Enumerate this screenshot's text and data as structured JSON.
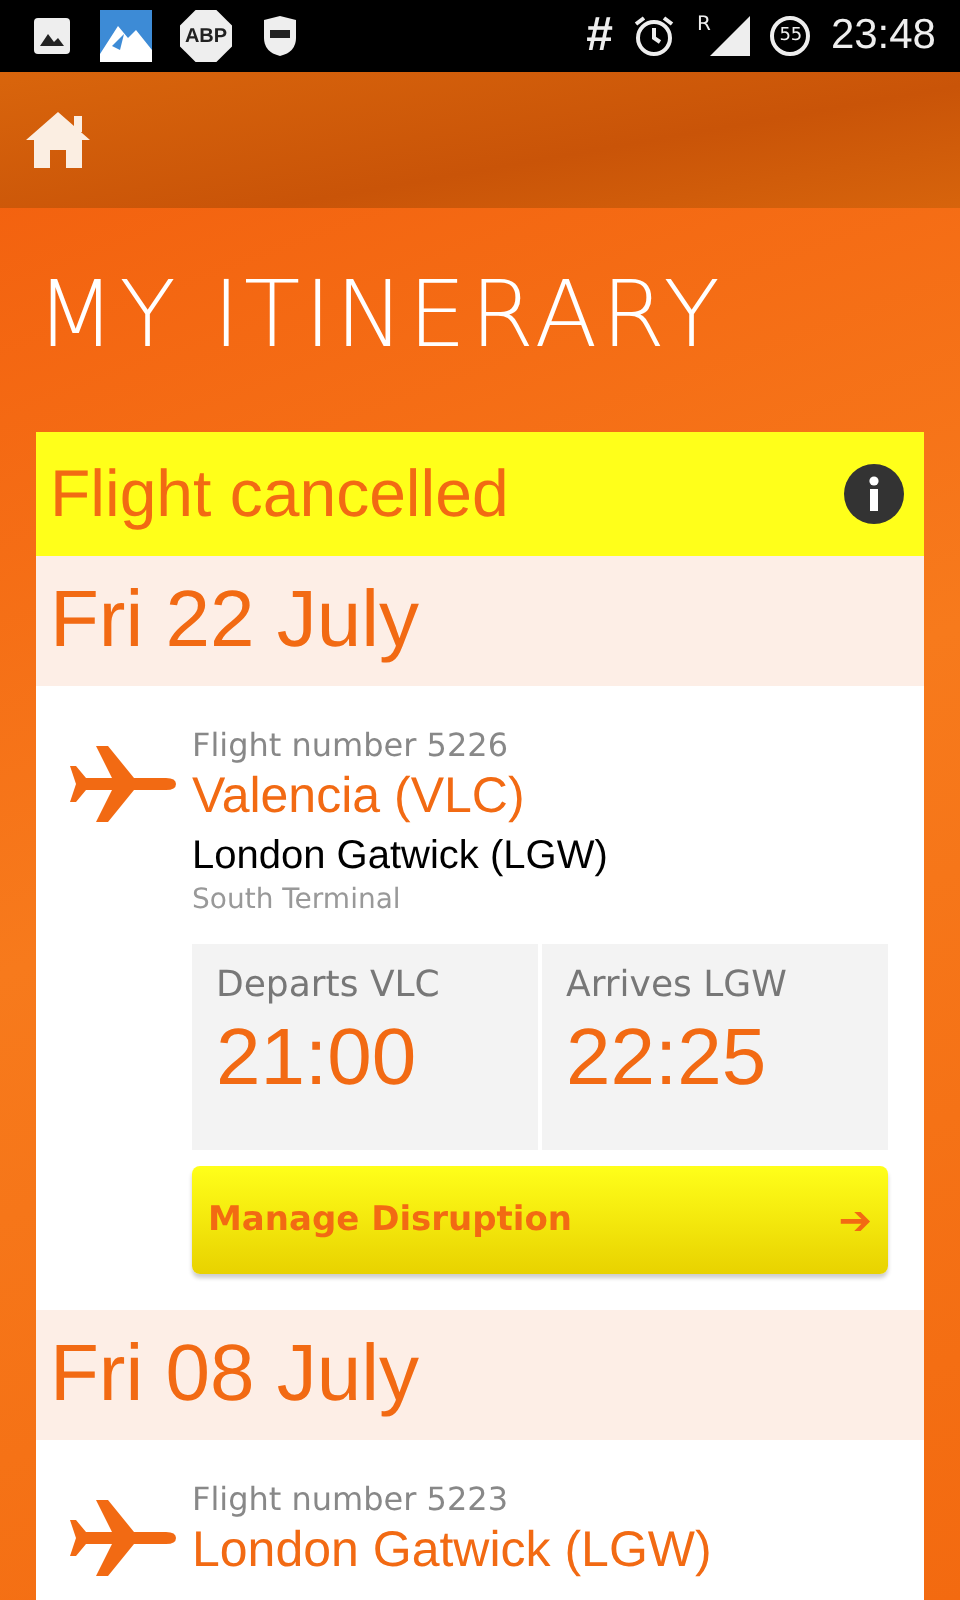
{
  "status_bar": {
    "adblock": "ABP",
    "hash": "#",
    "roaming": "R",
    "battery": "55",
    "time": "23:48"
  },
  "title": "MY ITINERARY",
  "banner": {
    "text": "Flight cancelled"
  },
  "flights": [
    {
      "date": "Fri 22 July",
      "flight_number": "Flight number 5226",
      "origin": "Valencia (VLC)",
      "destination": "London Gatwick (LGW)",
      "terminal": "South Terminal",
      "departs_label": "Departs VLC",
      "departs_time": "21:00",
      "arrives_label": "Arrives LGW",
      "arrives_time": "22:25",
      "action": "Manage Disruption",
      "arrow": "➔"
    },
    {
      "date": "Fri 08 July",
      "flight_number": "Flight number 5223",
      "origin": "London Gatwick (LGW)"
    }
  ]
}
